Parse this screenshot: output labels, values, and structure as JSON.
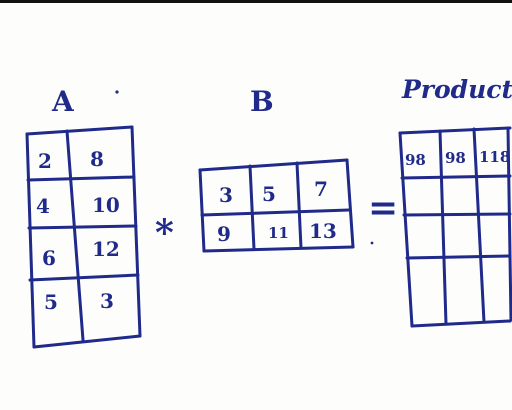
{
  "matrix_a": {
    "label": "A",
    "rows": [
      [
        "2",
        "8"
      ],
      [
        "4",
        "10"
      ],
      [
        "6",
        "12"
      ],
      [
        "5",
        "3"
      ]
    ]
  },
  "matrix_b": {
    "label": "B",
    "rows": [
      [
        "3",
        "5",
        "7"
      ],
      [
        "9",
        "11",
        "13"
      ]
    ]
  },
  "operator_multiply": "*",
  "operator_equals": "=",
  "product": {
    "label": "Product",
    "rows": [
      [
        "98",
        "98",
        "118"
      ],
      [
        "",
        "",
        ""
      ],
      [
        "",
        "",
        ""
      ],
      [
        "",
        "",
        ""
      ]
    ]
  },
  "colors": {
    "ink": "#1f2a8a",
    "paper": "#fdfdfb"
  }
}
